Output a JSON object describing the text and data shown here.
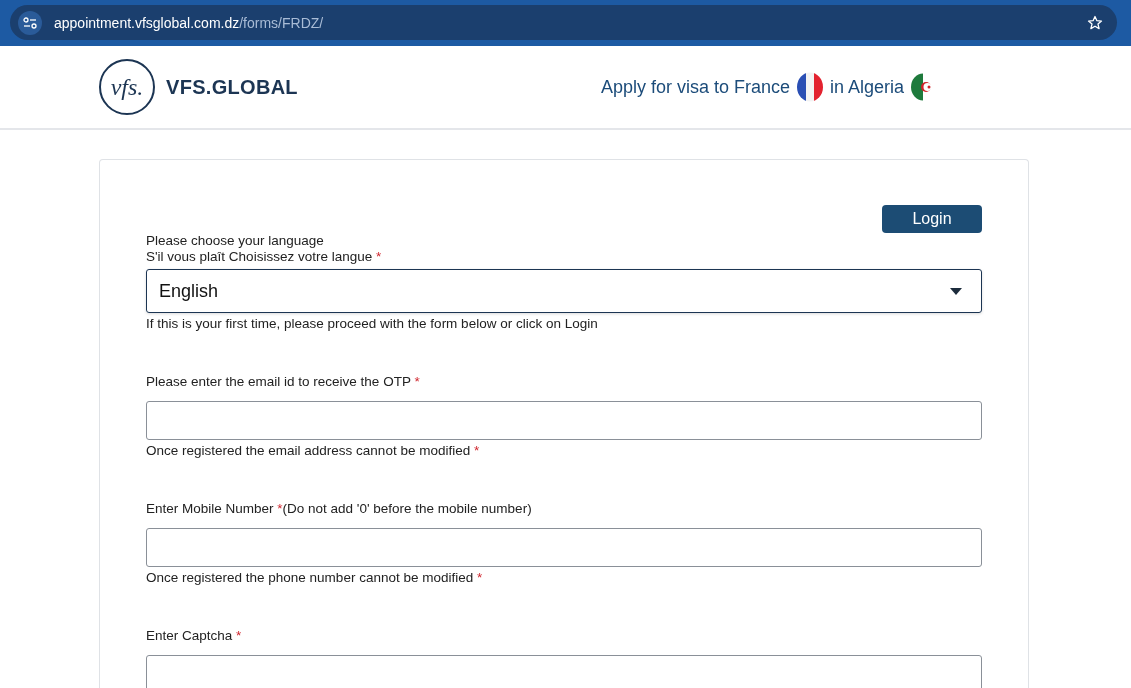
{
  "browser": {
    "url_host": "appointment.vfsglobal.com.dz",
    "url_path": "/forms/FRDZ/"
  },
  "header": {
    "logo_mark": "vfs.",
    "logo_text": "VFS.GLOBAL",
    "tagline_before": "Apply for visa to France",
    "tagline_after": "in Algeria"
  },
  "login_button": "Login",
  "language": {
    "label_lines": [
      "Please choose your language",
      "S'il vous plaît Choisissez votre langue"
    ],
    "required": "*",
    "value": "English",
    "help": "If this is your first time, please proceed with the form below or click on Login"
  },
  "fields": [
    {
      "label": "Please enter the email id to receive the OTP ",
      "required": "*",
      "note": "Once registered the email address cannot be modified ",
      "note_required": "*"
    },
    {
      "label": "Enter Mobile Number ",
      "required": "*",
      "label_after": "(Do not add '0' before the mobile number)",
      "note": "Once registered the phone number cannot be modified ",
      "note_required": "*"
    },
    {
      "label": "Enter Captcha ",
      "required": "*"
    }
  ]
}
